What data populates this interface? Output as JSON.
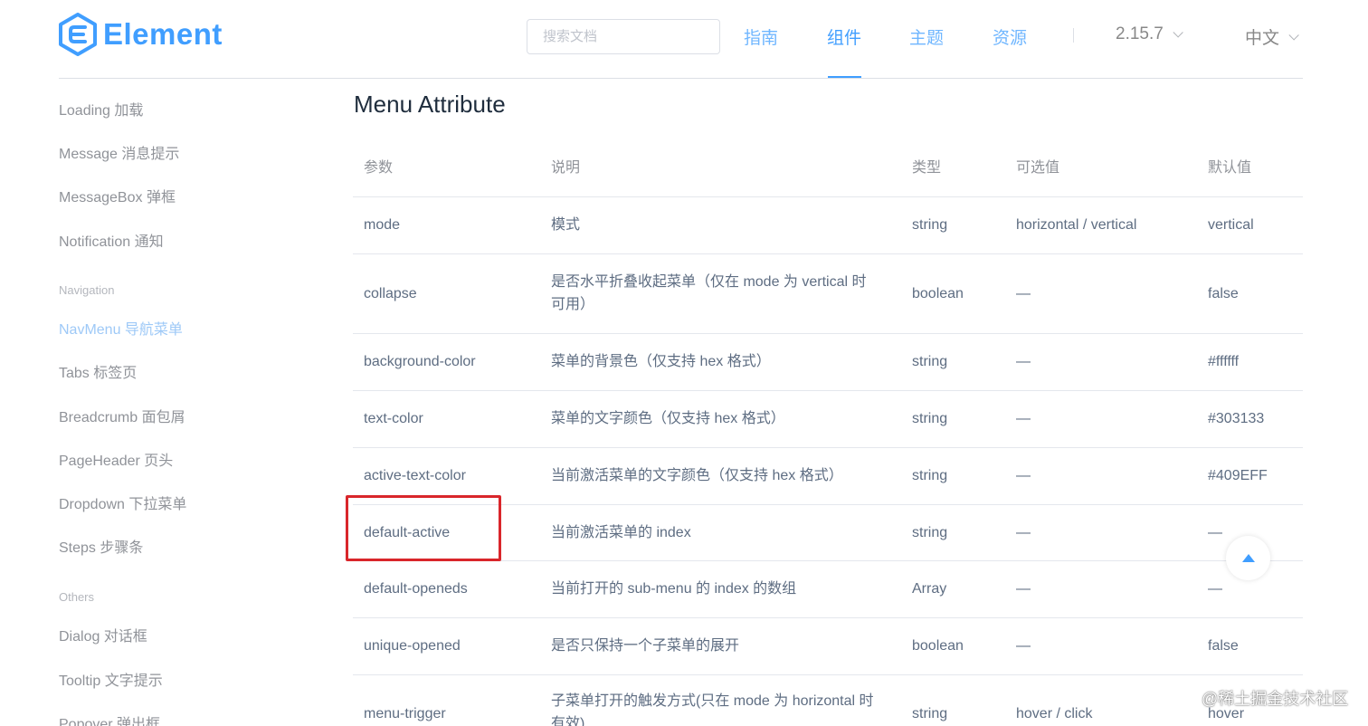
{
  "header": {
    "logo_text": "Element",
    "search_placeholder": "搜索文档",
    "nav": [
      {
        "label": "指南",
        "active": false
      },
      {
        "label": "组件",
        "active": true
      },
      {
        "label": "主题",
        "active": false
      },
      {
        "label": "资源",
        "active": false
      }
    ],
    "version": "2.15.7",
    "language": "中文"
  },
  "sidebar": {
    "items": [
      {
        "label": "Loading 加载"
      },
      {
        "label": "Message 消息提示"
      },
      {
        "label": "MessageBox 弹框"
      },
      {
        "label": "Notification 通知"
      }
    ],
    "group_navigation": "Navigation",
    "nav_items": [
      {
        "label": "NavMenu 导航菜单",
        "active": true
      },
      {
        "label": "Tabs 标签页"
      },
      {
        "label": "Breadcrumb 面包屑"
      },
      {
        "label": "PageHeader 页头"
      },
      {
        "label": "Dropdown 下拉菜单"
      },
      {
        "label": "Steps 步骤条"
      }
    ],
    "group_others": "Others",
    "other_items": [
      {
        "label": "Dialog 对话框"
      },
      {
        "label": "Tooltip 文字提示"
      },
      {
        "label": "Popover 弹出框"
      }
    ]
  },
  "main": {
    "title": "Menu Attribute",
    "table": {
      "headers": [
        "参数",
        "说明",
        "类型",
        "可选值",
        "默认值"
      ],
      "rows": [
        [
          "mode",
          "模式",
          "string",
          "horizontal / vertical",
          "vertical"
        ],
        [
          "collapse",
          "是否水平折叠收起菜单（仅在 mode 为 vertical 时可用）",
          "boolean",
          "—",
          "false"
        ],
        [
          "background-color",
          "菜单的背景色（仅支持 hex 格式）",
          "string",
          "—",
          "#ffffff"
        ],
        [
          "text-color",
          "菜单的文字颜色（仅支持 hex 格式）",
          "string",
          "—",
          "#303133"
        ],
        [
          "active-text-color",
          "当前激活菜单的文字颜色（仅支持 hex 格式）",
          "string",
          "—",
          "#409EFF"
        ],
        [
          "default-active",
          "当前激活菜单的 index",
          "string",
          "—",
          "—"
        ],
        [
          "default-openeds",
          "当前打开的 sub-menu 的 index 的数组",
          "Array",
          "—",
          "—"
        ],
        [
          "unique-opened",
          "是否只保持一个子菜单的展开",
          "boolean",
          "—",
          "false"
        ],
        [
          "menu-trigger",
          "子菜单打开的触发方式(只在 mode 为 horizontal 时有效)",
          "string",
          "hover / click",
          "hover"
        ]
      ]
    }
  },
  "watermark": "@稀土掘金技术社区",
  "colors": {
    "primary": "#409eff",
    "highlight_box": "#d9262b"
  }
}
